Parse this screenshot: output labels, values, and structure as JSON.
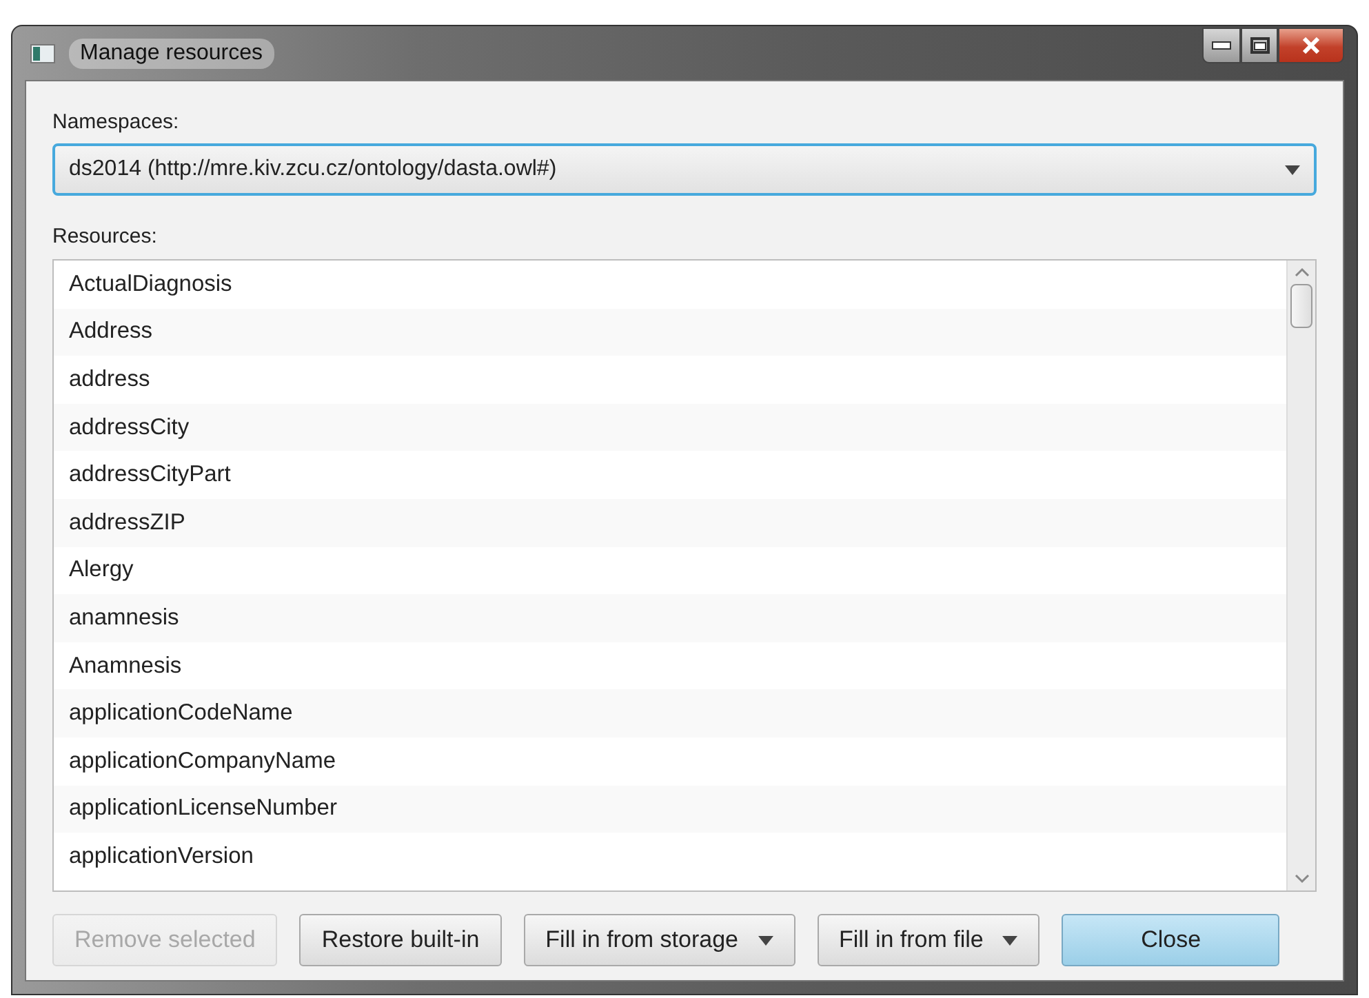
{
  "window": {
    "title": "Manage resources"
  },
  "namespaces": {
    "label": "Namespaces:",
    "value": "ds2014 (http://mre.kiv.zcu.cz/ontology/dasta.owl#)"
  },
  "resources": {
    "label": "Resources:",
    "items": [
      "ActualDiagnosis",
      "Address",
      "address",
      "addressCity",
      "addressCityPart",
      "addressZIP",
      "Alergy",
      "anamnesis",
      "Anamnesis",
      "applicationCodeName",
      "applicationCompanyName",
      "applicationLicenseNumber",
      "applicationVersion"
    ]
  },
  "buttons": [
    {
      "label": "Remove selected",
      "kind": "plain",
      "disabled": true
    },
    {
      "label": "Restore built-in",
      "kind": "plain",
      "disabled": false
    },
    {
      "label": "Fill in from storage",
      "kind": "menu",
      "disabled": false
    },
    {
      "label": "Fill in from file",
      "kind": "menu",
      "disabled": false
    },
    {
      "label": "Close",
      "kind": "default",
      "disabled": false
    }
  ]
}
